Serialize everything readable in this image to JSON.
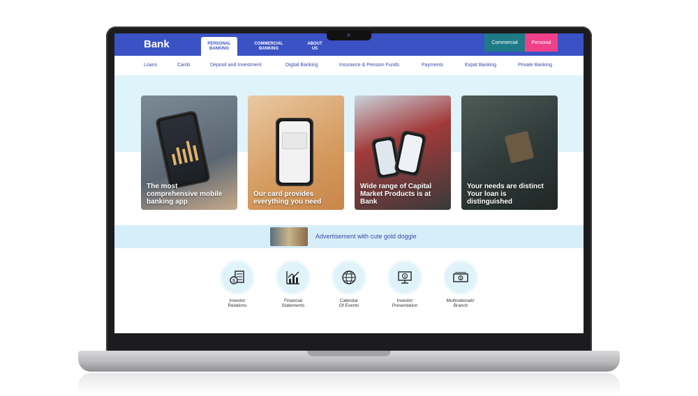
{
  "header": {
    "brand": "Bank",
    "tabs": [
      {
        "label_line1": "PERSONAL",
        "label_line2": "BANKING",
        "active": true
      },
      {
        "label_line1": "COMMERCIAL",
        "label_line2": "BANKING",
        "active": false
      },
      {
        "label_line1": "ABOUT",
        "label_line2": "US",
        "active": false
      }
    ],
    "commercial_label": "Commercial",
    "personal_label": "Personal"
  },
  "subnav": [
    "Loans",
    "Cards",
    "Deposit and Investment",
    "Digital Banking",
    "Insurance & Pension Funds",
    "Payments",
    "Expat Banking",
    "Private Banking"
  ],
  "cards": [
    {
      "caption_lines": [
        "The most",
        "comprehensive mobile",
        "banking app"
      ]
    },
    {
      "caption_lines": [
        "Our card provides",
        "everything you need"
      ]
    },
    {
      "caption_lines": [
        "Wide range of Capital",
        "Market Products is at",
        "Bank"
      ]
    },
    {
      "caption_lines": [
        "Your needs are distinct",
        "Your loan is",
        "distinguished"
      ]
    }
  ],
  "ad": {
    "text": "Advertisement with cute gold doggie"
  },
  "features": [
    {
      "line1": "Investor",
      "line2": "Relations",
      "icon": "investor-relations-icon"
    },
    {
      "line1": "Financial",
      "line2": "Statements",
      "icon": "financial-statements-icon"
    },
    {
      "line1": "Calendar",
      "line2": "Of Events",
      "icon": "calendar-globe-icon"
    },
    {
      "line1": "Investor",
      "line2": "Presentation",
      "icon": "presentation-icon"
    },
    {
      "line1": "Multinationals'",
      "line2": "Branch",
      "icon": "cash-icon"
    }
  ],
  "colors": {
    "header": "#3a52c4",
    "commercial": "#1e7a86",
    "personal": "#f0408a",
    "band": "#dff3fa",
    "nav_text": "#3a4aa8"
  }
}
